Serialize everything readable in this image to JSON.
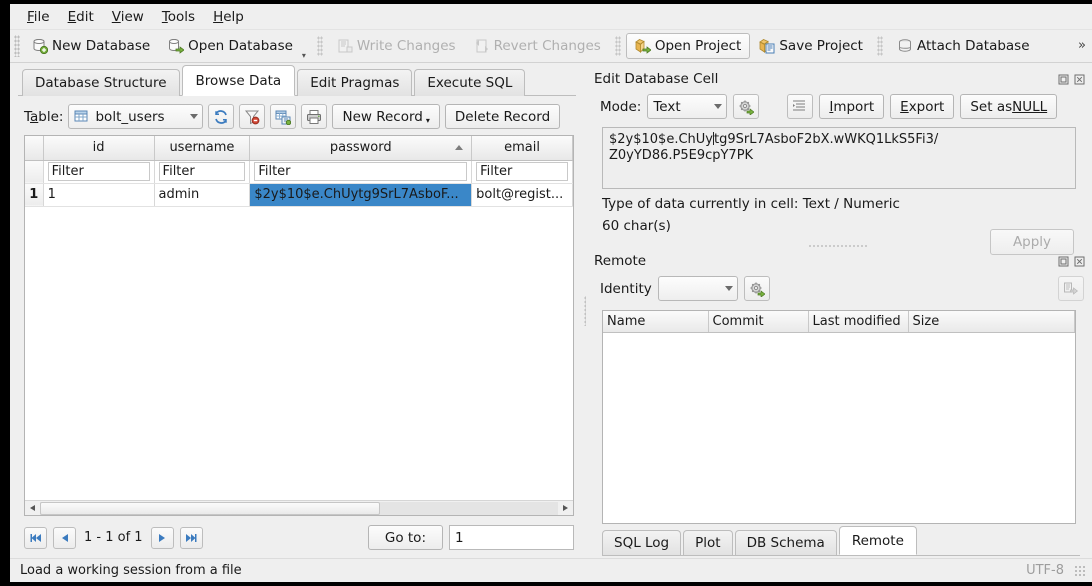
{
  "menu": {
    "items": [
      {
        "pre": "",
        "acc": "F",
        "post": "ile"
      },
      {
        "pre": "",
        "acc": "E",
        "post": "dit"
      },
      {
        "pre": "",
        "acc": "V",
        "post": "iew"
      },
      {
        "pre": "",
        "acc": "T",
        "post": "ools"
      },
      {
        "pre": "",
        "acc": "H",
        "post": "elp"
      }
    ]
  },
  "toolbar": {
    "new_database": "New Database",
    "open_database": "Open Database",
    "write_changes": "Write Changes",
    "revert_changes": "Revert Changes",
    "open_project": "Open Project",
    "save_project": "Save Project",
    "attach_database": "Attach Database",
    "overflow": "»"
  },
  "tabs": [
    {
      "label": "Database Structure",
      "active": false
    },
    {
      "label": "Browse Data",
      "active": true
    },
    {
      "label": "Edit Pragmas",
      "active": false
    },
    {
      "label": "Execute SQL",
      "active": false
    }
  ],
  "browse": {
    "table_label_pre": "T",
    "table_label_acc": "a",
    "table_label_post": "ble:",
    "table_value": "bolt_users",
    "new_record": "New Record",
    "delete_record": "Delete Record",
    "columns": [
      "id",
      "username",
      "password",
      "email"
    ],
    "sorted_column": "password",
    "filter_placeholder": "Filter",
    "rows": [
      {
        "rowno": "1",
        "id": "1",
        "username": "admin",
        "password": "$2y$10$e.ChUytg9SrL7AsboF...",
        "email": "bolt@regist..."
      }
    ]
  },
  "pager": {
    "first": "⏮",
    "prev": "◀",
    "range": "1 - 1 of 1",
    "next": "▶",
    "last": "⏭",
    "goto_label": "Go to:",
    "goto_value": "1"
  },
  "edit_cell": {
    "title": "Edit Database Cell",
    "mode_label": "Mode:",
    "mode_value": "Text",
    "import": "Import",
    "import_acc": "I",
    "export": "Export",
    "export_acc": "E",
    "set_null_pre": "Set as ",
    "set_null_acc": "NULL",
    "content_line1": "$2y$10$e.ChUy",
    "content_line1b": "tg9SrL7AsboF2bX.wWKQ1LkS5Fi3/",
    "content_line2": "Z0yYD86.P5E9cpY7PK",
    "type_info": "Type of data currently in cell: Text / Numeric",
    "char_count": "60 char(s)",
    "apply": "Apply"
  },
  "remote": {
    "title": "Remote",
    "identity_label": "Identity",
    "identity_value": "",
    "columns": [
      "Name",
      "Commit",
      "Last modified",
      "Size"
    ]
  },
  "bottom_tabs": [
    {
      "label": "SQL Log",
      "active": false
    },
    {
      "label": "Plot",
      "active": false
    },
    {
      "label": "DB Schema",
      "active": false
    },
    {
      "label": "Remote",
      "active": true
    }
  ],
  "status": {
    "message": "Load a working session from a file",
    "encoding": "UTF-8"
  },
  "colors": {
    "selection_blue": "#3a87c8",
    "window_bg": "#efefef",
    "accent_green": "#6aa84f"
  }
}
